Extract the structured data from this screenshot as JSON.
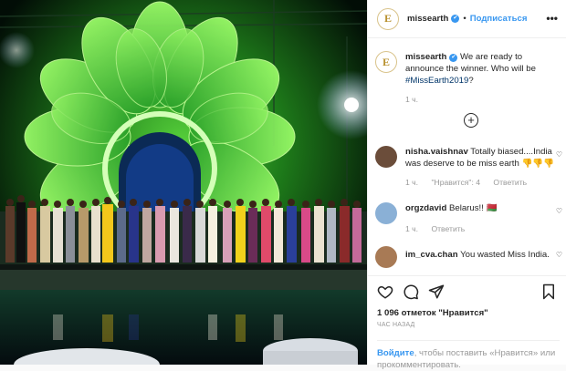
{
  "header": {
    "username": "missearth",
    "verified_mark": "✔",
    "separator": "•",
    "follow_label": "Подписаться",
    "more_label": "•••",
    "avatar_letter": "E"
  },
  "caption": {
    "username": "missearth",
    "text_before": "We are ready to announce the winner. Who will be ",
    "hashtag": "#MissEarth2019",
    "text_after": "?",
    "time": "1 ч."
  },
  "load_more_label": "+",
  "comments": [
    {
      "username": "nisha.vaishnav",
      "text": "Totally biased....India was deserve to be miss earth 👎👎👎",
      "time": "1 ч.",
      "likes": "\"Нравится\": 4",
      "reply": "Ответить",
      "heart": "♡"
    },
    {
      "username": "orgzdavid",
      "text": "Belarus!! 🇧🇾",
      "time": "1 ч.",
      "reply": "Ответить",
      "heart": "♡"
    },
    {
      "username": "im_cva.chan",
      "text": "You wasted Miss India.",
      "heart": "♡"
    }
  ],
  "actions": {
    "like_icon": "heart-outline-icon",
    "comment_icon": "speech-bubble-icon",
    "share_icon": "paper-plane-icon",
    "save_icon": "bookmark-icon",
    "likes_text": "1 096 отметок \"Нравится\"",
    "timestamp": "ЧАС НАЗАД"
  },
  "login_prompt": {
    "link": "Войдите",
    "text": ", чтобы поставить «Нравится» или прокомментировать."
  },
  "colors": {
    "accent": "#3897f0",
    "text": "#262626",
    "muted": "#999999",
    "stage_green": "#3fbf2a"
  }
}
